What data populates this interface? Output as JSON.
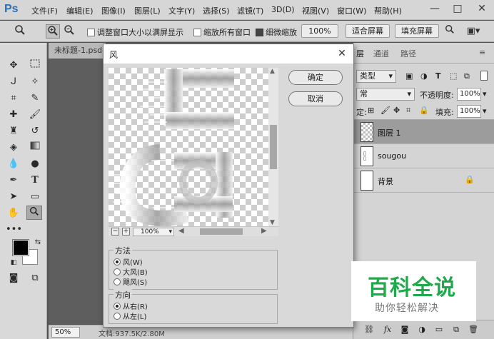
{
  "menubar": {
    "app_logo": "Ps",
    "items": [
      "文件(F)",
      "编辑(E)",
      "图像(I)",
      "图层(L)",
      "文字(Y)",
      "选择(S)",
      "滤镜(T)",
      "3D(D)",
      "视图(V)",
      "窗口(W)",
      "帮助(H)"
    ],
    "window_controls": {
      "minimize": "—",
      "restore": "□",
      "close": "✕"
    }
  },
  "options_bar": {
    "resize_windows_label": "调整窗口大小以满屏显示",
    "zoom_all_label": "缩放所有窗口",
    "scrubby_zoom_label": "细微缩放",
    "zoom_value": "100%",
    "fit_screen_label": "适合屏幕",
    "fill_screen_label": "填充屏幕"
  },
  "document": {
    "tab_title": "未标题-1.psd",
    "zoom": "50%",
    "info": "文档:937.5K/2.80M"
  },
  "layers_panel": {
    "tabs": [
      "层",
      "通道",
      "路径"
    ],
    "filter_kind": "类型",
    "blend_mode": "常",
    "opacity_label": "不透明度:",
    "opacity_value": "100%",
    "lock_label": "定:",
    "fill_label": "填充:",
    "fill_value": "100%",
    "layers": [
      {
        "name": "图层 1",
        "selected": true
      },
      {
        "name": "sougou",
        "selected": false
      },
      {
        "name": "背景",
        "selected": false,
        "locked": true
      }
    ]
  },
  "dialog": {
    "title": "风",
    "preview_zoom": "100%",
    "ok_label": "确定",
    "cancel_label": "取消",
    "method_legend": "方法",
    "method_options": [
      "风(W)",
      "大风(B)",
      "飓风(S)"
    ],
    "method_selected": 0,
    "direction_legend": "方向",
    "direction_options": [
      "从右(R)",
      "从左(L)"
    ],
    "direction_selected": 0
  },
  "watermark": {
    "title": "百科全说",
    "subtitle": "助你轻松解决"
  },
  "colors": {
    "foreground": "#000000",
    "background": "#ffffff",
    "accent_blue": "#2a6fb5",
    "watermark_green": "#1eaa4a"
  }
}
